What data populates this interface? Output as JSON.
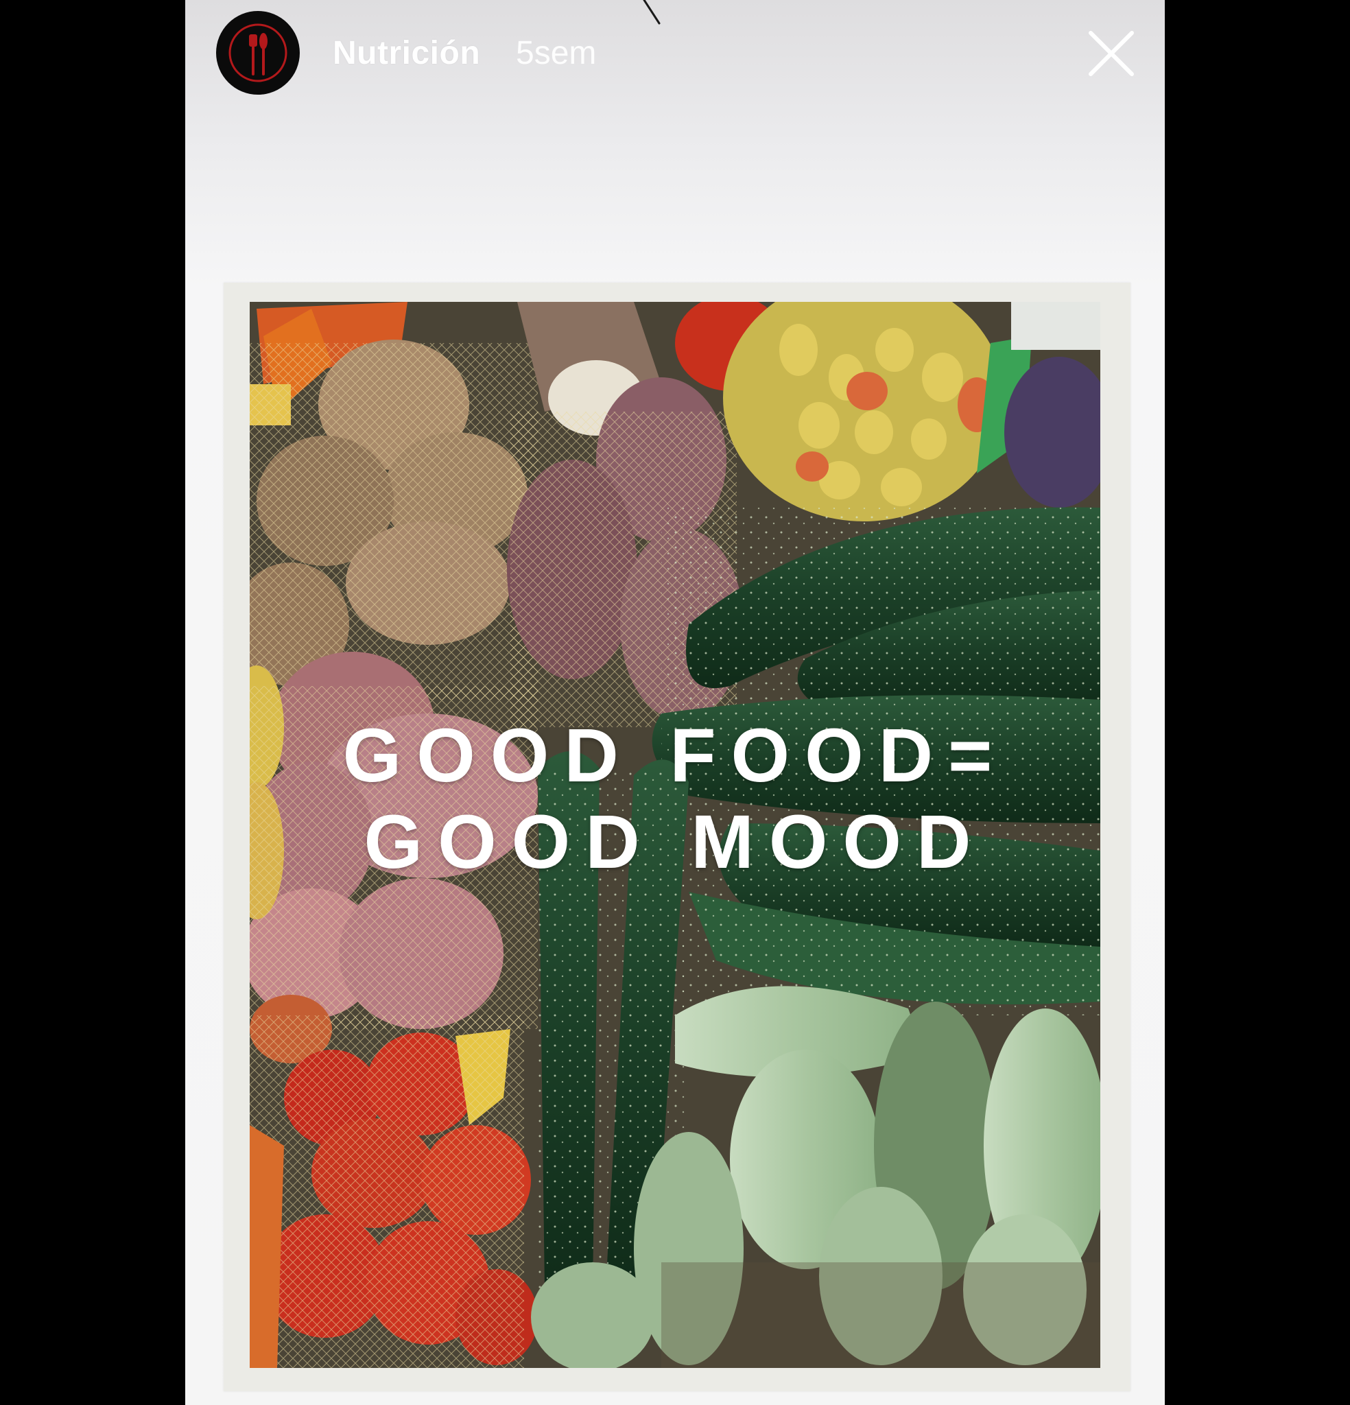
{
  "story": {
    "username": "Nutrición",
    "timestamp": "5sem",
    "avatar_icon": "fork-knife-icon",
    "close_icon": "close-icon"
  },
  "poster": {
    "headline_line1": "GOOD FOOD=",
    "headline_line2": "GOOD MOOD"
  },
  "colors": {
    "background": "#000000",
    "story_background": "#f2f2f3",
    "avatar": "#0b0b0b",
    "avatar_accent": "#b3191b",
    "text": "#ffffff"
  }
}
